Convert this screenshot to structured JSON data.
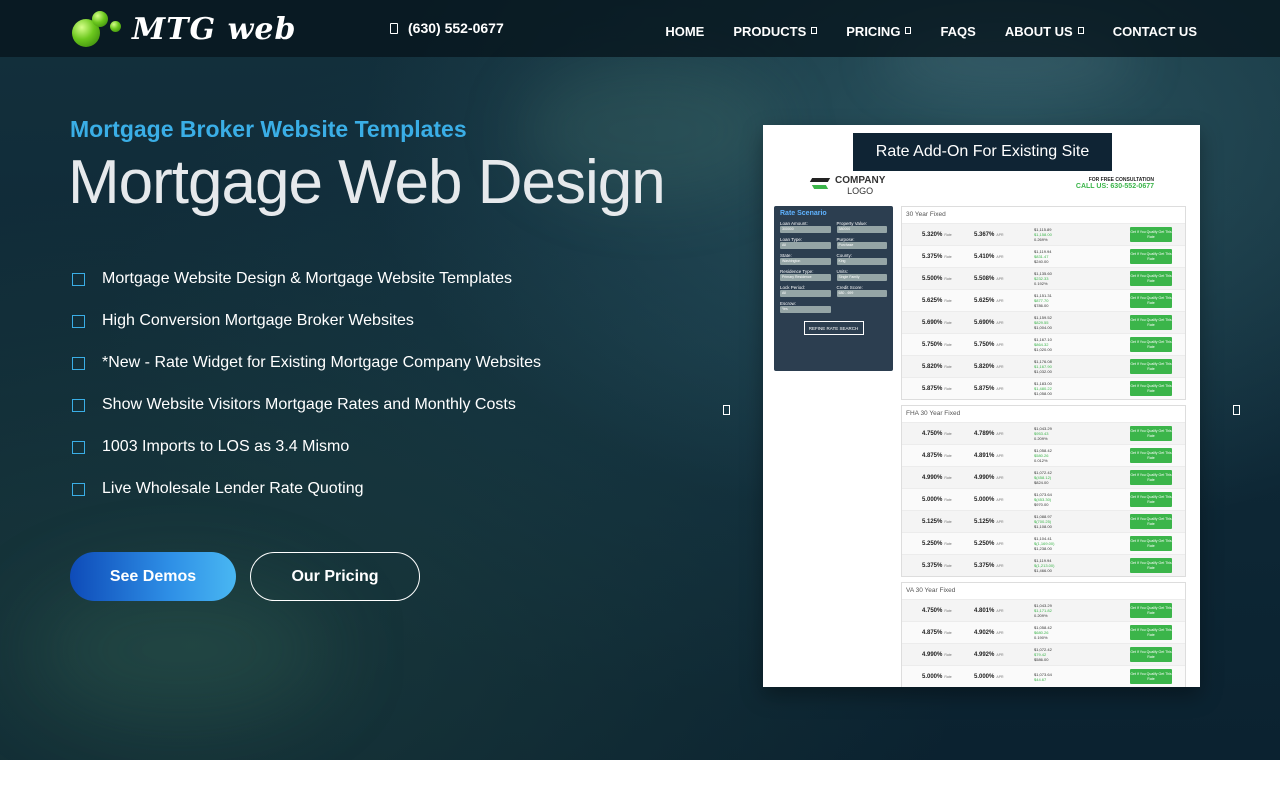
{
  "header": {
    "logo_text": "MTG web",
    "phone": "(630) 552-0677",
    "nav": [
      {
        "label": "HOME",
        "has_dropdown": false
      },
      {
        "label": "PRODUCTS",
        "has_dropdown": true
      },
      {
        "label": "PRICING",
        "has_dropdown": true
      },
      {
        "label": "FAQS",
        "has_dropdown": false
      },
      {
        "label": "ABOUT US",
        "has_dropdown": true
      },
      {
        "label": "CONTACT US",
        "has_dropdown": false
      }
    ]
  },
  "hero": {
    "eyebrow": "Mortgage Broker Website Templates",
    "headline": "Mortgage Web Design",
    "features": [
      "Mortgage Website Design & Mortgage Website Templates",
      "High Conversion Mortgage Broker Websites",
      "*New - Rate Widget for Existing Mortgage Company Websites",
      "Show Website Visitors Mortgage Rates and Monthly Costs",
      "1003 Imports to LOS as 3.4 Mismo",
      "Live Wholesale Lender Rate Quoting"
    ],
    "buttons": {
      "demos": "See Demos",
      "pricing": "Our Pricing"
    }
  },
  "slide": {
    "title": "Rate Add-On For Existing Site",
    "company_logo_top": "COMPANY",
    "company_logo_bottom": "LOGO",
    "consult_line": "FOR FREE CONSULTATION",
    "call_line": "CALL US: 630-552-0677",
    "scenario": {
      "title": "Rate Scenario",
      "fields": [
        {
          "label": "Loan Amount:",
          "value": "300000"
        },
        {
          "label": "Property Value:",
          "value": "380000"
        },
        {
          "label": "Loan Type:",
          "value": "All"
        },
        {
          "label": "Purpose:",
          "value": "Purchase"
        },
        {
          "label": "State:",
          "value": "Washington"
        },
        {
          "label": "County:",
          "value": "King"
        },
        {
          "label": "Residence Type:",
          "value": "Primary Residence"
        },
        {
          "label": "Units:",
          "value": "Single Family"
        },
        {
          "label": "Lock Period:",
          "value": "All"
        },
        {
          "label": "Credit Score:",
          "value": "680 - 699"
        },
        {
          "label": "Escrow:",
          "value": "Yes"
        }
      ],
      "button": "REFINE RATE SEARCH"
    },
    "rate_label": "Rate",
    "apr_label": "APR",
    "cta": "Get If You Qualify Get This Rate",
    "sections": [
      {
        "title": "30 Year Fixed",
        "rows": [
          {
            "rate": "5.320%",
            "apr": "5.367%",
            "payment": "$1,115.89",
            "closing": "$1,158.00",
            "points": "0.269%"
          },
          {
            "rate": "5.375%",
            "apr": "5.410%",
            "payment": "$1,119.94",
            "closing": "$831.47",
            "points": "$240.00"
          },
          {
            "rate": "5.500%",
            "apr": "5.508%",
            "payment": "$1,135.60",
            "closing": "$232.33",
            "points": "0.192%"
          },
          {
            "rate": "5.625%",
            "apr": "5.625%",
            "payment": "$1,151.31",
            "closing": "$877.70",
            "points": "$786.00"
          },
          {
            "rate": "5.690%",
            "apr": "5.690%",
            "payment": "$1,159.52",
            "closing": "$829.55",
            "points": "$1,004.00"
          },
          {
            "rate": "5.750%",
            "apr": "5.750%",
            "payment": "$1,167.10",
            "closing": "$864.32",
            "points": "$1,020.00"
          },
          {
            "rate": "5.820%",
            "apr": "5.820%",
            "payment": "$1,176.08",
            "closing": "$1,167.90",
            "points": "$1,032.00"
          },
          {
            "rate": "5.875%",
            "apr": "5.875%",
            "payment": "$1,183.00",
            "closing": "$1,480.22",
            "points": "$1,058.00"
          }
        ]
      },
      {
        "title": "FHA 30 Year Fixed",
        "rows": [
          {
            "rate": "4.750%",
            "apr": "4.789%",
            "payment": "$1,043.29",
            "closing": "$953.43",
            "points": "0.209%"
          },
          {
            "rate": "4.875%",
            "apr": "4.891%",
            "payment": "$1,058.42",
            "closing": "$580.26",
            "points": "0.012%"
          },
          {
            "rate": "4.990%",
            "apr": "4.990%",
            "payment": "$1,072.42",
            "closing": "$(458.12)",
            "points": "$824.00"
          },
          {
            "rate": "5.000%",
            "apr": "5.000%",
            "payment": "$1,073.64",
            "closing": "$(453.30)",
            "points": "$970.00"
          },
          {
            "rate": "5.125%",
            "apr": "5.125%",
            "payment": "$1,088.97",
            "closing": "$(700.25)",
            "points": "$1,108.00"
          },
          {
            "rate": "5.250%",
            "apr": "5.250%",
            "payment": "$1,104.41",
            "closing": "$(1,169.00)",
            "points": "$1,238.00"
          },
          {
            "rate": "5.375%",
            "apr": "5.375%",
            "payment": "$1,119.94",
            "closing": "$(1,213.00)",
            "points": "$1,466.00"
          }
        ]
      },
      {
        "title": "VA 30 Year Fixed",
        "rows": [
          {
            "rate": "4.750%",
            "apr": "4.801%",
            "payment": "$1,043.29",
            "closing": "$1,171.82",
            "points": "0.209%"
          },
          {
            "rate": "4.875%",
            "apr": "4.902%",
            "payment": "$1,058.42",
            "closing": "$680.26",
            "points": "0.190%"
          },
          {
            "rate": "4.990%",
            "apr": "4.992%",
            "payment": "$1,072.42",
            "closing": "$79.42",
            "points": "$586.00"
          },
          {
            "rate": "5.000%",
            "apr": "5.000%",
            "payment": "$1,073.64",
            "closing": "$44.67",
            "points": ""
          }
        ]
      }
    ]
  },
  "colors": {
    "accent_blue": "#3aaee6",
    "green": "#3bb54a",
    "nav_bg": "#06141c"
  }
}
